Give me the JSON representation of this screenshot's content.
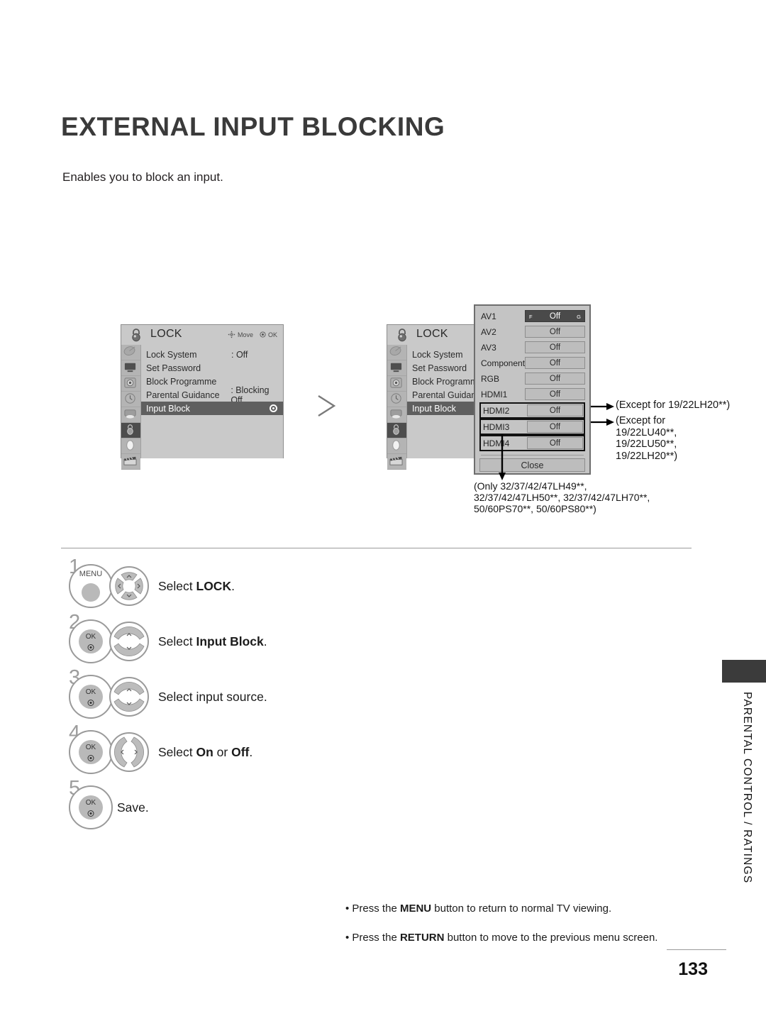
{
  "page": {
    "title": "EXTERNAL INPUT BLOCKING",
    "intro": "Enables you to block an input.",
    "number": "133",
    "side_label": "PARENTAL CONTROL / RATINGS"
  },
  "osd": {
    "title": "LOCK",
    "hints": {
      "move": "Move",
      "ok": "OK"
    },
    "menu_left": [
      {
        "label": "Lock System",
        "value": ": Off",
        "selected": false
      },
      {
        "label": "Set Password",
        "value": "",
        "selected": false
      },
      {
        "label": "Block Programme",
        "value": "",
        "selected": false
      },
      {
        "label": "Parental Guidance",
        "value": ": Blocking Off",
        "selected": false
      },
      {
        "label": "Input Block",
        "value": "",
        "selected": true
      }
    ],
    "menu_right": [
      {
        "label": "Lock System",
        "value": "",
        "selected": false
      },
      {
        "label": "Set Password",
        "value": "",
        "selected": false
      },
      {
        "label": "Block Programme",
        "value": "",
        "selected": false
      },
      {
        "label": "Parental Guidance",
        "value": "",
        "selected": false
      },
      {
        "label": "Input Block",
        "value": "",
        "selected": true
      }
    ],
    "rail_icons": [
      "satellite-dish-icon",
      "picture-icon",
      "audio-icon",
      "time-icon",
      "option-icon",
      "lock-icon",
      "usb-icon",
      "movie-icon"
    ]
  },
  "input_panel": {
    "rows": [
      {
        "name": "AV1",
        "state": "Off",
        "selected": true,
        "boxed": false,
        "left_arrow": "F",
        "right_arrow": "G"
      },
      {
        "name": "AV2",
        "state": "Off",
        "selected": false,
        "boxed": false
      },
      {
        "name": "AV3",
        "state": "Off",
        "selected": false,
        "boxed": false
      },
      {
        "name": "Component",
        "state": "Off",
        "selected": false,
        "boxed": false
      },
      {
        "name": "RGB",
        "state": "Off",
        "selected": false,
        "boxed": false
      },
      {
        "name": "HDMI1",
        "state": "Off",
        "selected": false,
        "boxed": false
      },
      {
        "name": "HDMI2",
        "state": "Off",
        "selected": false,
        "boxed": true
      },
      {
        "name": "HDMI3",
        "state": "Off",
        "selected": false,
        "boxed": true
      },
      {
        "name": "HDMI4",
        "state": "Off",
        "selected": false,
        "boxed": true
      }
    ],
    "close_label": "Close"
  },
  "annotations": {
    "hdmi2_note": "(Except for 19/22LH20**)",
    "hdmi3_note": "(Except for\n19/22LU40**,\n19/22LU50**,\n19/22LH20**)",
    "hdmi4_note": "(Only 32/37/42/47LH49**,\n32/37/42/47LH50**, 32/37/42/47LH70**,\n50/60PS70**, 50/60PS80**)"
  },
  "steps": [
    {
      "num": "1",
      "button": "MENU",
      "control": "wheel4",
      "text_before": "Select ",
      "text_bold": "LOCK",
      "text_after": "."
    },
    {
      "num": "2",
      "button": "OK",
      "control": "updown",
      "text_before": "Select ",
      "text_bold": "Input Block",
      "text_after": "."
    },
    {
      "num": "3",
      "button": "OK",
      "control": "updown",
      "text_before": "Select input source.",
      "text_bold": "",
      "text_after": ""
    },
    {
      "num": "4",
      "button": "OK",
      "control": "leftright",
      "text_before": "Select ",
      "text_bold": "On",
      "text_mid": " or ",
      "text_bold2": "Off",
      "text_after": "."
    },
    {
      "num": "5",
      "button": "OK",
      "control": "none",
      "text_before": "Save.",
      "text_bold": "",
      "text_after": ""
    }
  ],
  "footer": {
    "note1_a": "• Press the ",
    "note1_b": "MENU",
    "note1_c": " button to return to normal TV viewing.",
    "note2_a": "• Press the ",
    "note2_b": "RETURN",
    "note2_c": " button to move to the previous menu screen."
  },
  "colors": {
    "panel_bg": "#c9c9c9",
    "selected_row": "#5f5f5f",
    "selected_btn": "#4a4a4a",
    "side_tab": "#3b3b3b"
  }
}
